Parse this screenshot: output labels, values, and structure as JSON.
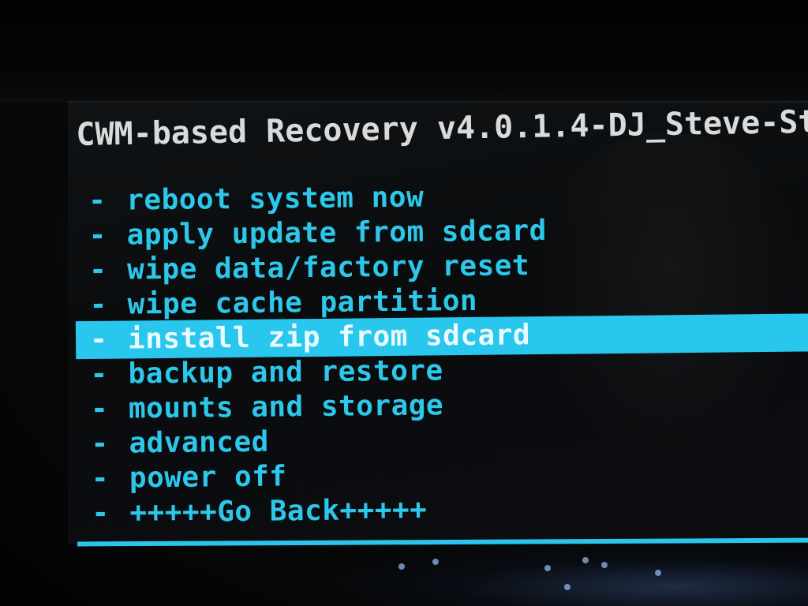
{
  "header": {
    "title": "CWM-based Recovery v4.0.1.4-DJ_Steve-St"
  },
  "menu": {
    "selected_index": 4,
    "dash": "-",
    "items": [
      {
        "label": "reboot system now"
      },
      {
        "label": "apply update from sdcard"
      },
      {
        "label": "wipe data/factory reset"
      },
      {
        "label": "wipe cache partition"
      },
      {
        "label": "install zip from sdcard"
      },
      {
        "label": "backup and restore"
      },
      {
        "label": "mounts and storage"
      },
      {
        "label": "advanced"
      },
      {
        "label": "power off"
      },
      {
        "label": "+++++Go Back+++++"
      }
    ]
  },
  "colors": {
    "menu_text": "#2dc7ea",
    "highlight_bar": "#29c6ee",
    "header_text": "#d8dadb",
    "background": "#0a0c0e"
  }
}
